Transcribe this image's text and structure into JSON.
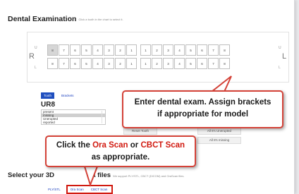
{
  "section": {
    "title": "Dental Examination",
    "hint": "Click a tooth in the chart to select it."
  },
  "chart": {
    "right_label": "R",
    "left_label": "L",
    "upper_small": "U",
    "lower_small": "L",
    "upper_teeth": [
      "8",
      "7",
      "6",
      "5",
      "4",
      "3",
      "2",
      "1",
      "1",
      "2",
      "3",
      "4",
      "5",
      "6",
      "7",
      "8"
    ],
    "lower_teeth": [
      "8",
      "7",
      "6",
      "5",
      "4",
      "3",
      "2",
      "1",
      "1",
      "2",
      "3",
      "4",
      "5",
      "6",
      "7",
      "8"
    ],
    "selected_upper_index": 0
  },
  "detail": {
    "tabs": [
      "Tooth",
      "Brackets"
    ],
    "active_tab": "Tooth",
    "tooth_name": "UR8",
    "status_options": [
      "present",
      "missing",
      "Unerupted",
      "reported"
    ],
    "selected_status": "missing",
    "reset_label": "Reset Tooth",
    "all_unerupted_label": "All 8's Unerupted",
    "all_missing_label": "All 8's missing"
  },
  "callouts": {
    "brackets_line1": "Enter dental exam. Assign brackets",
    "brackets_line2": "if appropriate for model",
    "scan_pre": "Click the ",
    "scan_ora": "Ora Scan",
    "scan_or": " or ",
    "scan_cbct": "CBCT Scan",
    "scan_line2": "as appropriate."
  },
  "files": {
    "title_start": "Select your 3D",
    "title_end": "ta files",
    "hint": "We support PLY/STL, CBCT (DICOM) and OraScan files.",
    "tabs": [
      "PLY/STL",
      "Ora Scan",
      "CBCT Scan"
    ]
  },
  "colors": {
    "accent": "#1f4fbf",
    "callout_red": "#d44238",
    "highlight_red": "#d11a10"
  }
}
